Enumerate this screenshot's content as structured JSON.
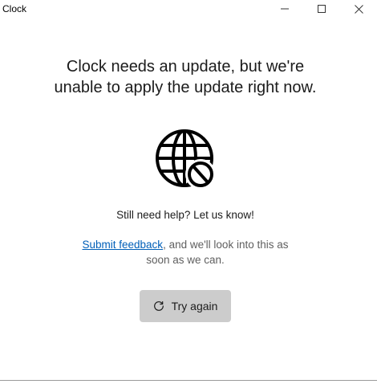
{
  "window": {
    "title": "Clock",
    "controls": {
      "minimize": "minimize-icon",
      "maximize": "maximize-icon",
      "close": "close-icon"
    }
  },
  "message": {
    "line1": "Clock needs an update, but we're",
    "line2": "unable to apply the update right now.",
    "icon": "globe-blocked-icon"
  },
  "help": {
    "prompt": "Still need help? Let us know!",
    "link_label": "Submit feedback",
    "link_suffix": ", and we'll look into this as soon as we can."
  },
  "actions": {
    "try_again_label": "Try again",
    "try_again_icon": "refresh-icon"
  },
  "colors": {
    "link": "#005fb8",
    "button_bg": "#cccccc",
    "text": "#1b1b1b",
    "secondary_text": "#5f5f5f"
  }
}
